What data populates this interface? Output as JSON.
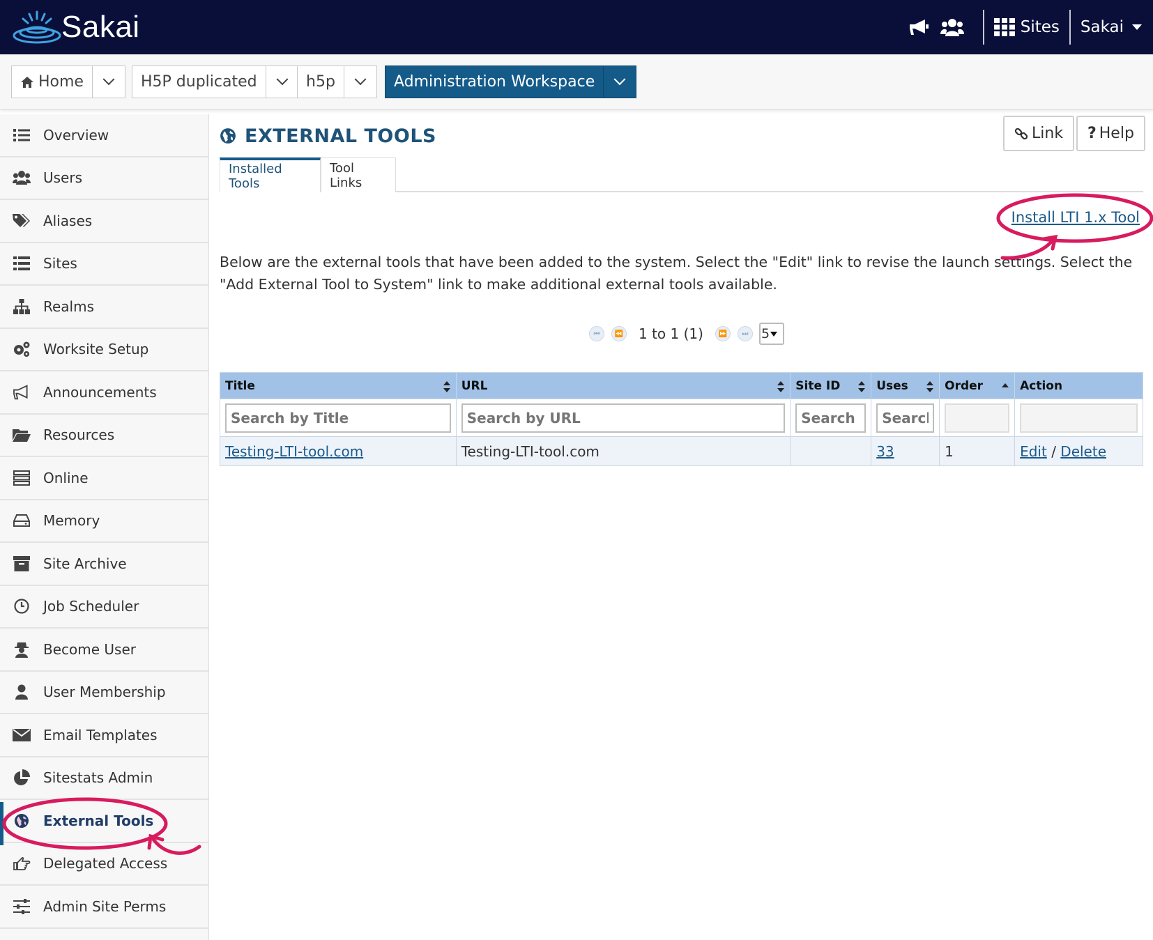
{
  "brand": {
    "name": "Sakai"
  },
  "topnav": {
    "sites_label": "Sites",
    "user_label": "Sakai"
  },
  "site_tabs": [
    {
      "label": "Home"
    },
    {
      "label": "H5P duplicated"
    },
    {
      "label": "h5p"
    },
    {
      "label": "Administration Workspace"
    }
  ],
  "sidebar": {
    "items": [
      {
        "label": "Overview",
        "icon": "list-icon"
      },
      {
        "label": "Users",
        "icon": "users-icon"
      },
      {
        "label": "Aliases",
        "icon": "tags-icon"
      },
      {
        "label": "Sites",
        "icon": "sites-list-icon"
      },
      {
        "label": "Realms",
        "icon": "sitemap-icon"
      },
      {
        "label": "Worksite Setup",
        "icon": "gears-icon"
      },
      {
        "label": "Announcements",
        "icon": "megaphone-icon"
      },
      {
        "label": "Resources",
        "icon": "folder-icon"
      },
      {
        "label": "Online",
        "icon": "server-icon"
      },
      {
        "label": "Memory",
        "icon": "hdd-icon"
      },
      {
        "label": "Site Archive",
        "icon": "archive-icon"
      },
      {
        "label": "Job Scheduler",
        "icon": "clock-icon"
      },
      {
        "label": "Become User",
        "icon": "user-secret-icon"
      },
      {
        "label": "User Membership",
        "icon": "user-icon"
      },
      {
        "label": "Email Templates",
        "icon": "envelope-icon"
      },
      {
        "label": "Sitestats Admin",
        "icon": "pie-chart-icon"
      },
      {
        "label": "External Tools",
        "icon": "globe-icon"
      },
      {
        "label": "Delegated Access",
        "icon": "hand-point-icon"
      },
      {
        "label": "Admin Site Perms",
        "icon": "sliders-icon"
      }
    ],
    "active_label": "External Tools"
  },
  "page": {
    "title": "EXTERNAL TOOLS",
    "link_button": "Link",
    "help_button": "Help",
    "tabs": [
      {
        "label": "Installed Tools"
      },
      {
        "label": "Tool Links"
      }
    ],
    "install_link": "Install LTI 1.x Tool",
    "description": "Below are the external tools that have been added to the system. Select the \"Edit\" link to revise the launch settings. Select the \"Add External Tool to System\" link to make additional external tools available."
  },
  "pager": {
    "range_text": "1 to 1 (1)",
    "page_size": "5"
  },
  "table": {
    "columns": [
      {
        "label": "Title"
      },
      {
        "label": "URL"
      },
      {
        "label": "Site ID"
      },
      {
        "label": "Uses"
      },
      {
        "label": "Order"
      },
      {
        "label": "Action"
      }
    ],
    "filters": {
      "title_placeholder": "Search by Title",
      "url_placeholder": "Search by URL",
      "siteid_placeholder": "Search by Site ID",
      "uses_placeholder": "Search by Uses"
    },
    "rows": [
      {
        "title": "Testing-LTI-tool.com",
        "url": "Testing-LTI-tool.com",
        "site_id": "",
        "uses": "33",
        "order": "1",
        "edit": "Edit",
        "sep": "/",
        "delete": "Delete"
      }
    ]
  },
  "colors": {
    "topbar": "#0a0f3a",
    "accent": "#145b8a",
    "table_header": "#a1c2e6",
    "annotation": "#d81b5e"
  }
}
